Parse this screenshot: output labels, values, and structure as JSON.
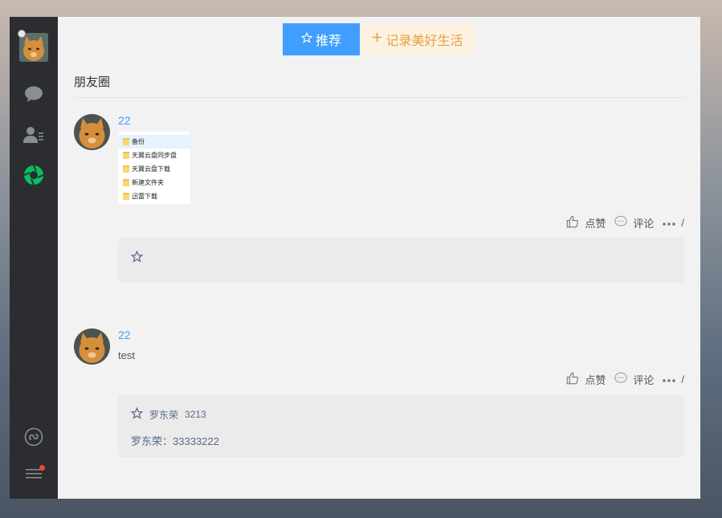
{
  "sidebar": {
    "items": [
      {
        "name": "avatar",
        "icon": "cat-avatar"
      },
      {
        "name": "chat",
        "icon": "chat-bubble-icon"
      },
      {
        "name": "contacts",
        "icon": "contacts-icon"
      },
      {
        "name": "moments",
        "icon": "moments-aperture-icon"
      },
      {
        "name": "mini-program",
        "icon": "mini-program-icon"
      },
      {
        "name": "menu",
        "icon": "hamburger-menu-icon"
      }
    ],
    "accent": "#07c160"
  },
  "tabs": {
    "recommend_label": "推荐",
    "record_label": "记录美好生活"
  },
  "section_title": "朋友圈",
  "posts": [
    {
      "user": "22",
      "image_files": [
        "备份",
        "天翼云盘同步盘",
        "天翼云盘下载",
        "新建文件夹",
        "迅雷下载"
      ],
      "like_label": "点赞",
      "comment_label": "评论",
      "more_label": "/"
    },
    {
      "user": "22",
      "text": "test",
      "like_label": "点赞",
      "comment_label": "评论",
      "more_label": "/",
      "likers": "罗东荣",
      "liker_count": "3213",
      "comment": "罗东荣：33333222"
    }
  ],
  "colors": {
    "link_blue": "#409eff",
    "record_orange": "#e6a23c",
    "sidebar_bg": "#2b2d31"
  }
}
